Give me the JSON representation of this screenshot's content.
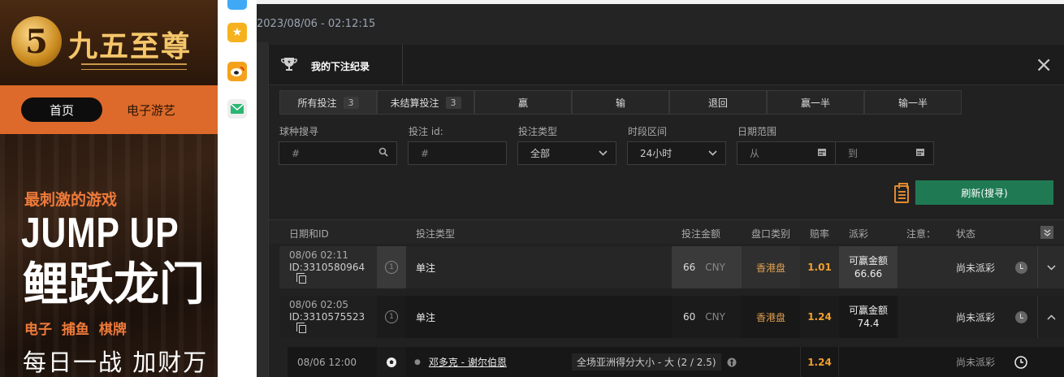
{
  "background_site": {
    "logo_text": "九五至尊",
    "nav": {
      "home": "首页",
      "games": "电子游艺"
    },
    "hero": {
      "tagline": "最刺激的游戏",
      "headline_en": "JUMP UP",
      "headline_cn": "鲤跃龙门",
      "categories": "电子 捕鱼 棋牌",
      "slogan": "每日一战 加财万"
    }
  },
  "share_icons": [
    "star-icon",
    "weibo-icon",
    "email-icon"
  ],
  "app": {
    "datetime": "2023/08/06 - 02:12:15"
  },
  "modal": {
    "title": "我的下注纪录",
    "close": "×",
    "tabs": [
      {
        "label": "所有投注",
        "count": "3"
      },
      {
        "label": "未结算投注",
        "count": "3"
      },
      {
        "label": "赢",
        "count": ""
      },
      {
        "label": "输",
        "count": ""
      },
      {
        "label": "退回",
        "count": ""
      },
      {
        "label": "赢一半",
        "count": ""
      },
      {
        "label": "输一半",
        "count": ""
      }
    ],
    "filters": {
      "sport_label": "球种搜寻",
      "sport_placeholder": "#",
      "bet_id_label": "投注 id:",
      "bet_id_placeholder": "#",
      "bet_type_label": "投注类型",
      "bet_type_value": "全部",
      "period_label": "时段区间",
      "period_value": "24小时",
      "date_label": "日期范围",
      "date_from": "从",
      "date_to": "到"
    },
    "refresh_label": "刷新(搜寻)",
    "table": {
      "headers": [
        "日期和ID",
        "投注类型",
        "投注金额",
        "盘口类别",
        "赔率",
        "派彩",
        "注意：",
        "状态"
      ],
      "rows": [
        {
          "date": "08/06 02:11",
          "id": "ID:3310580964",
          "num": "1",
          "type": "单注",
          "amount": "66",
          "currency": "CNY",
          "market": "香港盘",
          "odds": "1.01",
          "win_label": "可赢金额",
          "win_value": "66.66",
          "status": "尚未派彩",
          "chevron": "⌄"
        },
        {
          "date": "08/06 02:05",
          "id": "ID:3310575523",
          "num": "1",
          "type": "单注",
          "amount": "60",
          "currency": "CNY",
          "market": "香港盘",
          "odds": "1.24",
          "win_label": "可赢金额",
          "win_value": "74.4",
          "status": "尚未派彩",
          "chevron": "⌃"
        }
      ],
      "detail": {
        "date": "08/06 12:00",
        "match": "邓多克 - 谢尔伯恩",
        "selection": "全场亚洲得分大小 - 大 (2 / 2.5)",
        "odds": "1.24",
        "status": "尚未派彩"
      }
    }
  }
}
